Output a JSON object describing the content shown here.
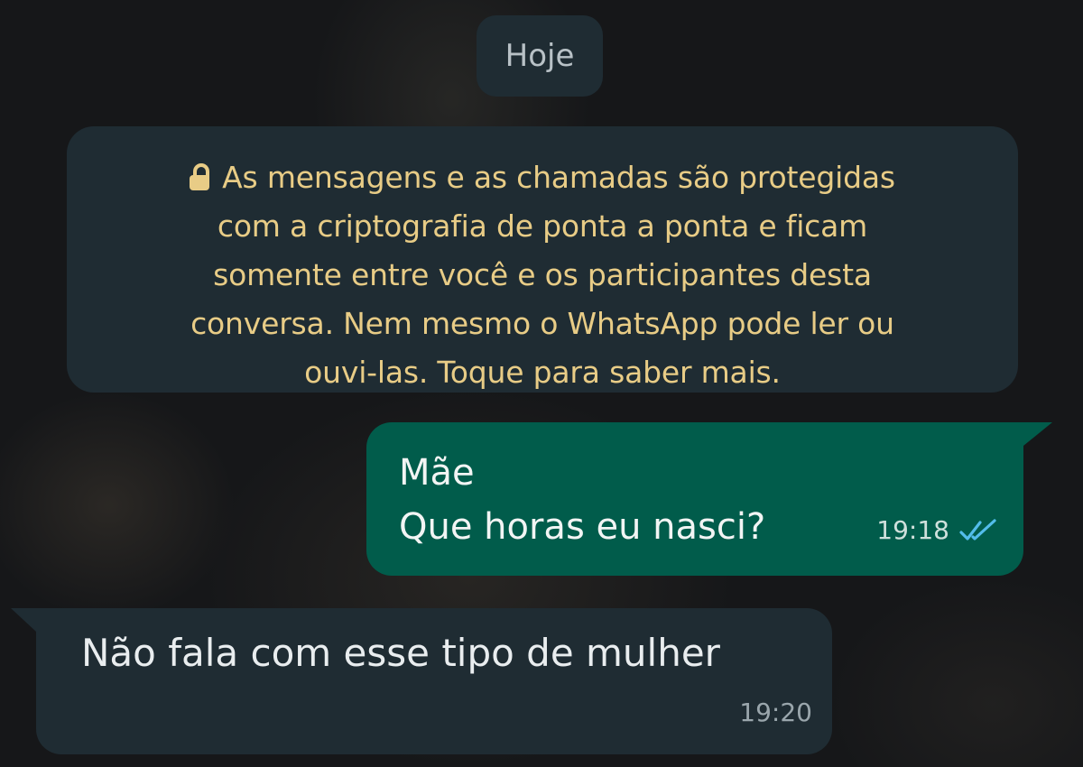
{
  "date_chip": {
    "label": "Hoje"
  },
  "encryption_notice": {
    "icon": "lock-icon",
    "lines": [
      "As mensagens e as chamadas são protegidas",
      "com a criptografia de ponta a ponta e ficam",
      "somente entre você e os participantes desta",
      "conversa. Nem mesmo o WhatsApp pode ler ou",
      "ouvi-las. Toque para saber mais."
    ]
  },
  "messages": [
    {
      "direction": "outgoing",
      "lines": [
        "Mãe",
        "Que horas eu nasci?"
      ],
      "time": "19:18",
      "status_icon": "double-check-icon",
      "status": "read"
    },
    {
      "direction": "incoming",
      "lines": [
        "Não fala com esse tipo de mulher"
      ],
      "time": "19:20"
    }
  ],
  "colors": {
    "background": "#161719",
    "incoming_bubble": "#1f2c33",
    "outgoing_bubble": "#015c4b",
    "notice_text": "#e8cc86",
    "read_receipt": "#53bdeb"
  }
}
